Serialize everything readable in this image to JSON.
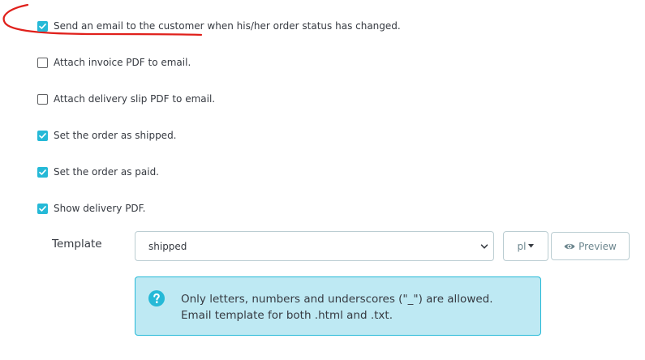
{
  "checkboxes": [
    {
      "label": "Send an email to the customer when his/her order status has changed.",
      "checked": true
    },
    {
      "label": "Attach invoice PDF to email.",
      "checked": false
    },
    {
      "label": "Attach delivery slip PDF to email.",
      "checked": false
    },
    {
      "label": "Set the order as shipped.",
      "checked": true
    },
    {
      "label": "Set the order as paid.",
      "checked": true
    },
    {
      "label": "Show delivery PDF.",
      "checked": true
    }
  ],
  "template": {
    "label": "Template",
    "selected": "shipped",
    "language": "pl",
    "preview_label": "Preview"
  },
  "info": {
    "line1": "Only letters, numbers and underscores (\"_\") are allowed.",
    "line2": "Email template for both .html and .txt."
  },
  "icons": {
    "checkmark": "check-icon",
    "select": "chevron-down-icon",
    "language": "caret-down-icon",
    "preview": "eye-icon",
    "info": "question-circle-icon"
  },
  "colors": {
    "accent": "#25b9d7",
    "info_bg": "#bee9f3",
    "annotation": "#e0201b",
    "text": "#363a41",
    "muted": "#6c868e",
    "border": "#bbcdd2"
  }
}
